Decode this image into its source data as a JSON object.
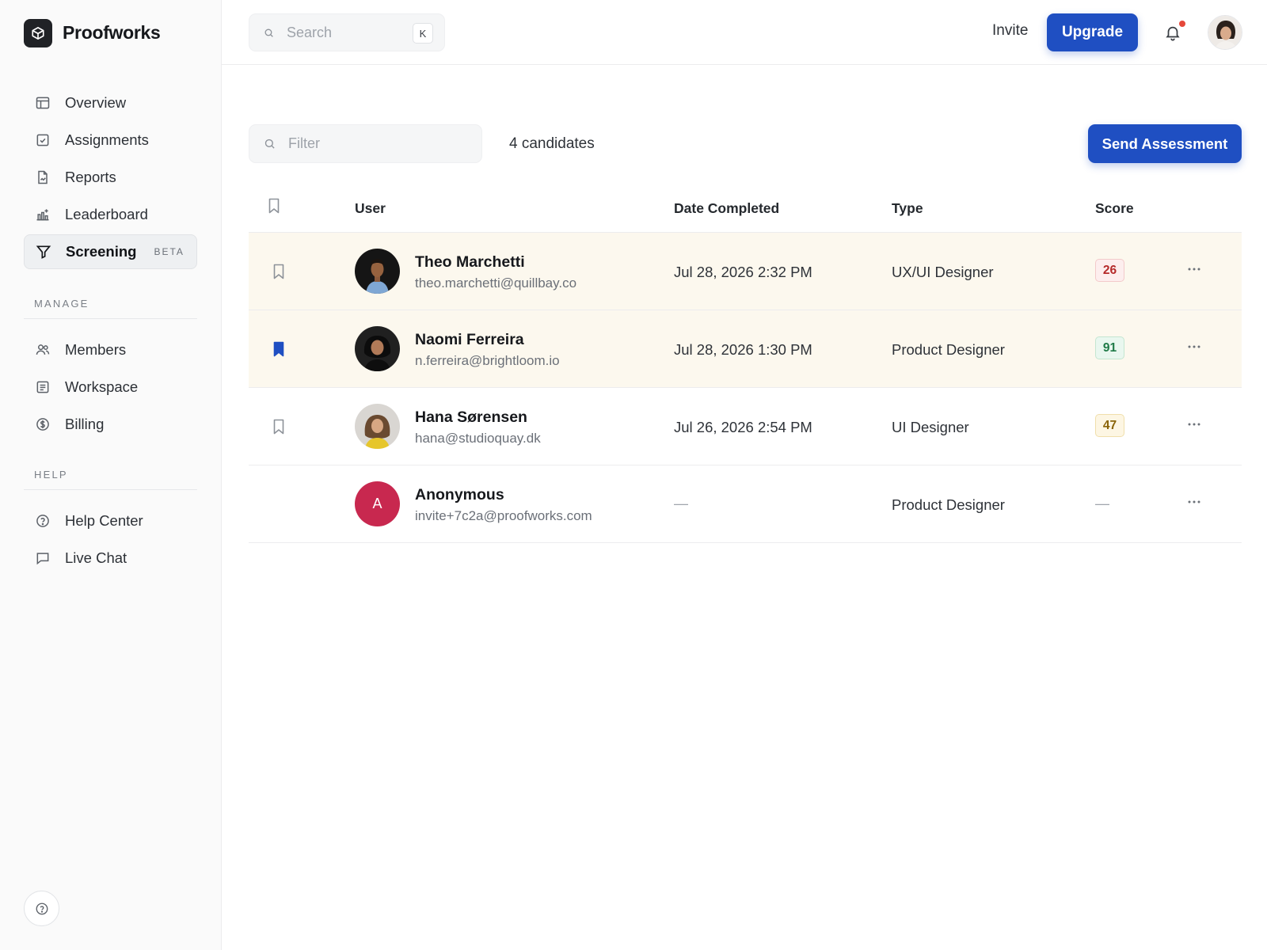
{
  "brand": {
    "name": "Proofworks"
  },
  "sidebar": {
    "nav": [
      {
        "label": "Overview",
        "icon": "layout-icon"
      },
      {
        "label": "Assignments",
        "icon": "checkbox-icon"
      },
      {
        "label": "Reports",
        "icon": "report-icon"
      },
      {
        "label": "Leaderboard",
        "icon": "leaderboard-icon"
      },
      {
        "label": "Screening",
        "icon": "filter-funnel-icon",
        "badge": "BETA",
        "active": true
      }
    ],
    "manage_label": "MANAGE",
    "manage": [
      {
        "label": "Members",
        "icon": "users-icon"
      },
      {
        "label": "Workspace",
        "icon": "workspace-icon"
      },
      {
        "label": "Billing",
        "icon": "dollar-circle-icon"
      }
    ],
    "help_label": "HELP",
    "help": [
      {
        "label": "Help Center",
        "icon": "question-circle-icon"
      },
      {
        "label": "Live Chat",
        "icon": "chat-bubble-icon"
      }
    ]
  },
  "topbar": {
    "search_placeholder": "Search",
    "search_shortcut": "K",
    "invite_label": "Invite",
    "upgrade_label": "Upgrade",
    "has_notification": true
  },
  "toolbar": {
    "filter_placeholder": "Filter",
    "candidate_count": "4 candidates",
    "send_label": "Send Assessment"
  },
  "table": {
    "columns": [
      "User",
      "Date Completed",
      "Type",
      "Score"
    ],
    "rows": [
      {
        "name": "Theo Marchetti",
        "email": "theo.marchetti@quillbay.co",
        "date": "Jul 28, 2026 2:32 PM",
        "type": "UX/UI Designer",
        "score": "26",
        "score_level": "low",
        "bookmarked": false,
        "highlighted": true
      },
      {
        "name": "Naomi Ferreira",
        "email": "n.ferreira@brightloom.io",
        "date": "Jul 28, 2026 1:30 PM",
        "type": "Product Designer",
        "score": "91",
        "score_level": "high",
        "bookmarked": true,
        "highlighted": true
      },
      {
        "name": "Hana Sørensen",
        "email": "hana@studioquay.dk",
        "date": "Jul 26, 2026 2:54 PM",
        "type": "UI Designer",
        "score": "47",
        "score_level": "mid",
        "bookmarked": false,
        "highlighted": false
      },
      {
        "name": "Anonymous",
        "initial": "A",
        "email": "invite+7c2a@proofworks.com",
        "date": "—",
        "type": "Product Designer",
        "score": "—",
        "score_level": "none",
        "bookmarked": null,
        "highlighted": false
      }
    ]
  },
  "colors": {
    "accent": "#1f4fc2",
    "row_highlight": "#fcf8ee",
    "anonymous_avatar": "#c8284f",
    "notification_dot": "#e5483a"
  }
}
